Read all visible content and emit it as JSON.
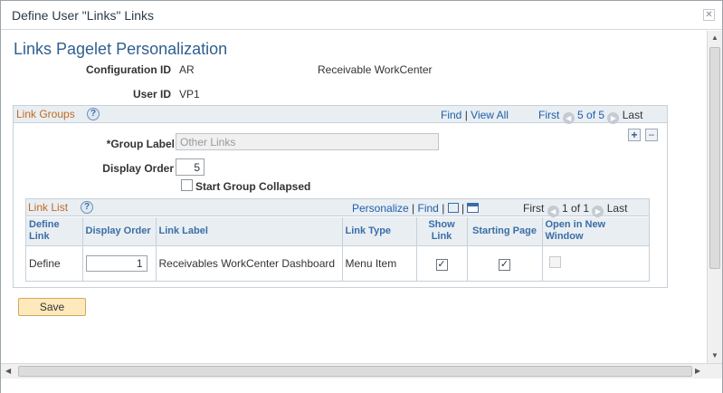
{
  "window": {
    "title": "Define User \"Links\" Links",
    "close_glyph": "✕"
  },
  "page": {
    "title": "Links Pagelet Personalization"
  },
  "config": {
    "config_id_label": "Configuration ID",
    "config_id_value": "AR",
    "config_desc": "Receivable WorkCenter",
    "user_id_label": "User ID",
    "user_id_value": "VP1"
  },
  "link_groups": {
    "title": "Link Groups",
    "help_icon": "?",
    "find": "Find",
    "sep": "|",
    "view_all": "View All",
    "first": "First",
    "count": "5 of 5",
    "last": "Last",
    "group_label_label": "*Group Label",
    "group_label_value": "Other Links",
    "display_order_label": "Display Order",
    "display_order_value": "5",
    "start_collapsed_label": "Start Group Collapsed"
  },
  "link_list": {
    "title": "Link List",
    "personalize": "Personalize",
    "find": "Find",
    "first": "First",
    "count": "1 of 1",
    "last": "Last",
    "columns": {
      "define_link": "Define Link",
      "display_order": "Display Order",
      "link_label": "Link Label",
      "link_type": "Link Type",
      "show_link": "Show Link",
      "starting_page": "Starting Page",
      "open_new_window": "Open in New Window"
    },
    "rows": [
      {
        "define": "Define",
        "order": "1",
        "label": "Receivables WorkCenter Dashboard",
        "type": "Menu Item",
        "show_link": true,
        "starting_page": true,
        "open_new_window": false
      }
    ]
  },
  "buttons": {
    "save": "Save"
  },
  "icons": {
    "help": "help-icon",
    "add": "+",
    "remove": "−",
    "prev": "◀",
    "next": "▶",
    "check": "✓"
  }
}
